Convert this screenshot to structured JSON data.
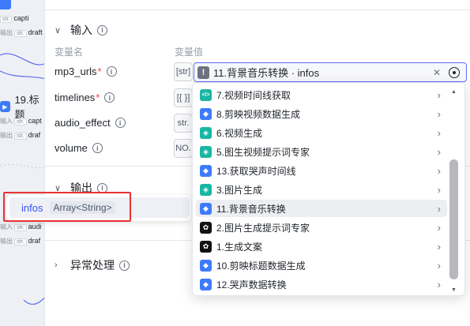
{
  "canvas": {
    "top_field_1": {
      "tag": "str.",
      "value": "capti"
    },
    "top_field_2": {
      "tag": "str.",
      "value": "draft"
    },
    "top_label_2": "输出",
    "node_title": "19.标题",
    "mid_label_1": "输入",
    "mid_field_1": {
      "tag": "str.",
      "value": "capt"
    },
    "mid_label_2": "输出",
    "mid_field_2": {
      "tag": "str.",
      "value": "draf"
    },
    "low_label_1": "输入",
    "low_field_1": {
      "tag": "str.",
      "value": "audi"
    },
    "low_label_2": "输出",
    "low_field_2": {
      "tag": "str.",
      "value": "draf"
    }
  },
  "input_section": {
    "title": "输入",
    "col_name": "变量名",
    "col_value": "变量值",
    "params": [
      {
        "name": "mp3_urls",
        "required": "*",
        "type_tag": "[str]"
      },
      {
        "name": "timelines",
        "required": "*",
        "type_tag": "[{ }]"
      },
      {
        "name": "audio_effect",
        "required": "",
        "type_tag": "str."
      },
      {
        "name": "volume",
        "required": "",
        "type_tag": "NO."
      }
    ],
    "selected_ref": "11.背景音乐转换 · infos"
  },
  "output_section": {
    "title": "输出",
    "var_name": "infos",
    "var_type": "Array<String>"
  },
  "exception_section": {
    "title": "异常处理"
  },
  "dropdown": {
    "items": [
      {
        "label": "7.视频时间线获取",
        "icon": "code-icon",
        "color": "#19b6a3"
      },
      {
        "label": "8.剪映视频数据生成",
        "icon": "plugin-icon",
        "color": "#3e7bfa"
      },
      {
        "label": "6.视频生成",
        "icon": "cube-icon",
        "color": "#19b6a3"
      },
      {
        "label": "5.图生视频提示词专家",
        "icon": "cube-icon",
        "color": "#19b6a3"
      },
      {
        "label": "13.获取哭声时间线",
        "icon": "plugin-icon",
        "color": "#3e7bfa"
      },
      {
        "label": "3.图片生成",
        "icon": "cube-icon",
        "color": "#19b6a3"
      },
      {
        "label": "11.背景音乐转换",
        "icon": "plugin-icon",
        "color": "#3e7bfa"
      },
      {
        "label": "2.图片生成提示词专家",
        "icon": "llm-icon",
        "color": "#111111"
      },
      {
        "label": "1.生成文案",
        "icon": "llm-icon",
        "color": "#111111"
      },
      {
        "label": "10.剪映标题数据生成",
        "icon": "plugin-icon",
        "color": "#3e7bfa"
      },
      {
        "label": "12.哭声数据转换",
        "icon": "plugin-icon",
        "color": "#3e7bfa"
      }
    ],
    "active_index": 6
  },
  "colors": {
    "accent": "#3955f6",
    "highlight_border": "#e83232",
    "focus_border": "#5b6cf5"
  }
}
